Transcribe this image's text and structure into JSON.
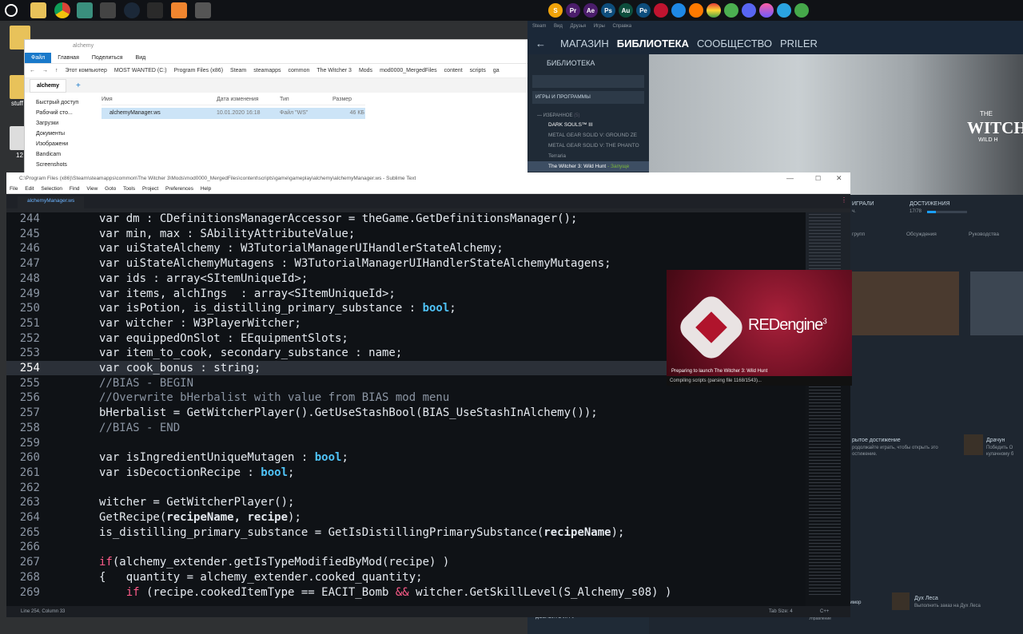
{
  "explorer": {
    "title": "alchemy",
    "ribbon": [
      "Файл",
      "Главная",
      "Поделиться",
      "Вид"
    ],
    "path": [
      "Этот компьютер",
      "MOST WANTED (C:)",
      "Program Files (x86)",
      "Steam",
      "steamapps",
      "common",
      "The Witcher 3",
      "Mods",
      "mod0000_MergedFiles",
      "content",
      "scripts",
      "ga"
    ],
    "tab": "alchemy",
    "nav": [
      "Быстрый доступ",
      "Рабочий сто...",
      "Загрузки",
      "Документы",
      "Изображени",
      "Bandicam",
      "Screenshots"
    ],
    "columns": [
      "Имя",
      "Дата изменения",
      "Тип",
      "Размер"
    ],
    "file": {
      "name": "alchemyManager.ws",
      "date": "10.01.2020 16:18",
      "type": "Файл \"WS\"",
      "size": "46 КБ"
    }
  },
  "desktop": {
    "labels": [
      "stuff",
      "12"
    ]
  },
  "sublime": {
    "title": "C:\\Program Files (x86)\\Steam\\steamapps\\common\\The Witcher 3\\Mods\\mod0000_MergedFiles\\content\\scripts\\game\\gameplay\\alchemy\\alchemyManager.ws - Sublime Text",
    "menu": [
      "File",
      "Edit",
      "Selection",
      "Find",
      "View",
      "Goto",
      "Tools",
      "Project",
      "Preferences",
      "Help"
    ],
    "tab": "alchemyManager.ws",
    "status_left": "Line 254, Column 33",
    "tab_size": "Tab Size: 4",
    "syntax": "C++",
    "line_numbers": [
      "244",
      "245",
      "246",
      "247",
      "248",
      "249",
      "250",
      "251",
      "252",
      "253",
      "254",
      "255",
      "256",
      "257",
      "258",
      "259",
      "260",
      "261",
      "262",
      "263",
      "264",
      "265",
      "266",
      "267",
      "268",
      "269"
    ]
  },
  "code": {
    "l244a": "var dm : CDefinitionsManagerAccessor = theGame.GetDefinitionsManager();",
    "l245a": "var min, max : SAbilityAttributeValue;",
    "l246a": "var uiStateAlchemy : W3TutorialManagerUIHandlerStateAlchemy;",
    "l247a": "var uiStateAlchemyMutagens : W3TutorialManagerUIHandlerStateAlchemyMutagens;",
    "l248a": "var ids : array<SItemUniqueId>;",
    "l249a": "var items, alchIngs  : array<SItemUniqueId>;",
    "l250a": "var isPotion, is_distilling_primary_substance : ",
    "l250b": "bool",
    "l250c": ";",
    "l251a": "var witcher : W3PlayerWitcher;",
    "l252a": "var equippedOnSlot : EEquipmentSlots;",
    "l253a": "var item_to_cook, secondary_substance : name;",
    "l254a": "var cook_bonus : string;",
    "l255a": "//BIAS - BEGIN",
    "l256a": "//Overwrite bHerbalist with value from BIAS mod menu",
    "l257a": "bHerbalist = GetWitcherPlayer().GetUseStashBool(BIAS_UseStashInAlchemy());",
    "l259a": "//BIAS - END",
    "l260a": "var isIngredientUniqueMutagen : ",
    "l260b": "bool",
    "l260c": ";",
    "l261a": "var isDecoctionRecipe : ",
    "l261b": "bool",
    "l261c": ";",
    "l263a": "witcher = GetWitcherPlayer();",
    "l264a": "GetRecipe(",
    "l264b": "recipeName, recipe",
    "l264c": ");",
    "l265a": "is_distilling_primary_substance = GetIsDistillingPrimarySubstance(",
    "l265b": "recipeName",
    "l265c": ");",
    "l267a": "if",
    "l267b": "(alchemy_extender.getIsTypeModifiedByMod(recipe) )",
    "l268a": "{   quantity = alchemy_extender.cooked_quantity;",
    "l269a": "    ",
    "l269b": "if",
    "l269c": " (recipe.cookedItemType == EACIT_Bomb ",
    "l269d": "&&",
    "l269e": " witcher.GetSkillLevel(S_Alchemy_s08) )"
  },
  "steam": {
    "topmenu": [
      "Steam",
      "Вид",
      "Друзья",
      "Игры",
      "Справка"
    ],
    "nav": [
      "МАГАЗИН",
      "БИБЛИОТЕКА",
      "СООБЩЕСТВО",
      "PRILER"
    ],
    "library_label": "БИБЛИОТЕКА",
    "filter": "ИГРЫ И ПРОГРАММЫ",
    "favorites": "— ИЗБРАННОЕ",
    "favorites_count": "(5)",
    "games": [
      "DARK SOULS™ III",
      "METAL GEAR SOLID V: GROUND ZE",
      "METAL GEAR SOLID V: THE PHANTO",
      "Terraria",
      "The Witcher 3: Wild Hunt"
    ],
    "launch_status": "- Запуще",
    "hero_line1": "THE",
    "hero_line2": "WITCH",
    "hero_line3": "WILD H",
    "played_label": "ИГРАЛИ",
    "played_sub": "ч.",
    "achievements_label": "ДОСТИЖЕНИЯ",
    "achievements_count": "17/78",
    "tabs": [
      "групп",
      "Обсуждения",
      "Руководства"
    ],
    "ach_title": "рытое достижение",
    "ach_desc1": "родолжайте играть, чтобы открыть это",
    "ach_desc2": "остижение.",
    "ach2_title": "Драчун",
    "ach2_desc1": "Победить О",
    "ach2_desc2": "кулачному б",
    "ach3_left": "римор",
    "ach3_title": "Дух Леса",
    "ach3_desc": "Выполнить заказ на Дух Леса",
    "add_game": "ДОБАВИТЬ ИГРУ",
    "downloads": "ЗАГРУЗКИ",
    "downloads_sub": "Управление"
  },
  "redengine": {
    "logo": "REDengine",
    "version": "3",
    "line1": "Preparing to launch The Witcher 3: Wild Hunt",
    "line2": "Compiling scripts (parsing file 1168/1543)..."
  }
}
